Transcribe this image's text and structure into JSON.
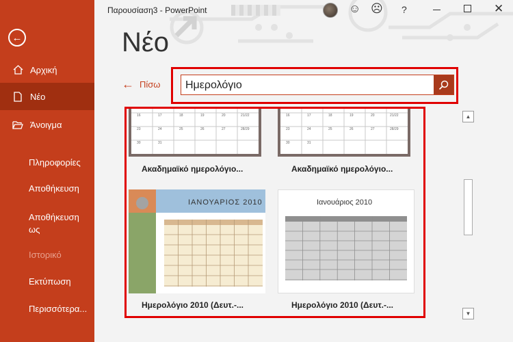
{
  "window": {
    "title": "Παρουσίαση3  -  PowerPoint",
    "help": "?",
    "minimize_icon": "minimize-icon",
    "maximize_icon": "maximize-icon",
    "close_icon": "close-icon"
  },
  "sidebar": {
    "back_icon": "back-arrow-icon",
    "items": [
      {
        "label": "Αρχική",
        "icon": "home-icon"
      },
      {
        "label": "Νέο",
        "icon": "new-document-icon"
      },
      {
        "label": "Άνοιγμα",
        "icon": "open-folder-icon"
      }
    ],
    "sub_items": [
      "Πληροφορίες",
      "Αποθήκευση",
      "Αποθήκευση ως",
      "Ιστορικό",
      "Εκτύπωση",
      "Περισσότερα..."
    ]
  },
  "main": {
    "title": "Νέο",
    "back_label": "Πίσω",
    "search": {
      "value": "Ημερολόγιο",
      "button_icon": "search-icon"
    }
  },
  "templates": [
    {
      "label": "Ακαδημαϊκό ημερολόγιο..."
    },
    {
      "label": "Ακαδημαϊκό ημερολόγιο..."
    },
    {
      "label": "Ημερολόγιο 2010 (Δευτ.-...",
      "month": "ΙΑΝΟΥΑΡΙΟΣ  2010"
    },
    {
      "label": "Ημερολόγιο 2010 (Δευτ.-...",
      "month": "Ιανουάριος  2010"
    }
  ],
  "partial_calendar_numbers": {
    "row1": [
      "16",
      "17",
      "18",
      "19",
      "20",
      "21/22"
    ],
    "row2": [
      "23",
      "24",
      "25",
      "26",
      "27",
      "28/29"
    ],
    "row3": [
      "30",
      "31"
    ]
  },
  "colors": {
    "sidebar": "#c43e1c",
    "sidebar_active": "#a02f10",
    "highlight": "#e00000"
  }
}
